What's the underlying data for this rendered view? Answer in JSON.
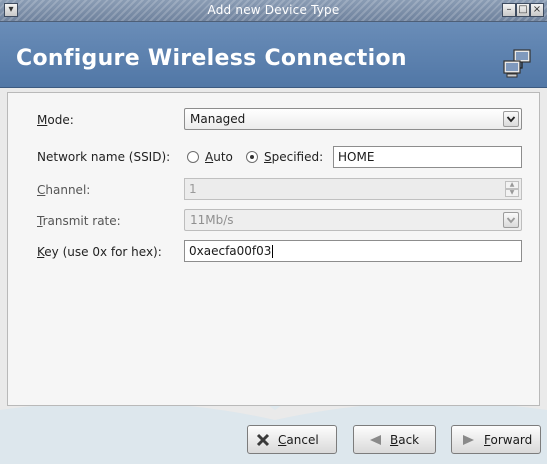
{
  "window": {
    "title": "Add new Device Type"
  },
  "header": {
    "heading": "Configure Wireless Connection"
  },
  "form": {
    "mode": {
      "label_underline": "M",
      "label_rest": "ode:",
      "value": "Managed"
    },
    "ssid": {
      "label": "Network name (SSID):",
      "auto_underline": "A",
      "auto_rest": "uto",
      "specified_underline": "S",
      "specified_rest": "pecified:",
      "selected": "specified",
      "value": "HOME"
    },
    "channel": {
      "label_underline": "C",
      "label_rest": "hannel:",
      "value": "1"
    },
    "rate": {
      "label_underline": "T",
      "label_rest": "ransmit rate:",
      "value": "11Mb/s"
    },
    "key": {
      "label_underline": "K",
      "label_rest": "ey (use 0x for hex):",
      "value": "0xaecfa00f03"
    }
  },
  "buttons": {
    "cancel_underline": "C",
    "cancel_rest": "ancel",
    "back_underline": "B",
    "back_rest": "ack",
    "forward_underline": "F",
    "forward_rest": "orward"
  },
  "icons": {
    "window_menu": "window-menu-icon",
    "minimize": "minimize-icon",
    "maximize": "maximize-icon",
    "close": "close-icon",
    "network": "network-icon",
    "cancel": "cancel-x-icon",
    "back": "back-arrow-icon",
    "forward": "forward-arrow-icon"
  },
  "colors": {
    "banner": "#5b80ad",
    "titlebar": "#7d90ab",
    "watermark": "#cfe3ef"
  }
}
